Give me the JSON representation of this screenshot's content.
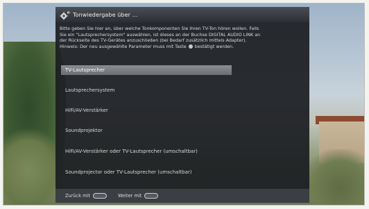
{
  "dialog": {
    "title": "Tonwiedergabe über ...",
    "description": [
      "Bitte geben Sie hier an, über welche Tonkomponenten Sie Ihren TV-Ton hören wollen. Falls",
      "Sie ein \"Lautsprechersystem\" auswählen, ist dieses an der Buchse DIGITAL AUDIO LINK an",
      "der Rückseite des TV-Gerätes anzuschließen (bei Bedarf zusätzlich mittels Adapter).",
      "Hinweis: Der neu ausgewählte Parameter muss mit Taste",
      "bestätigt werden."
    ],
    "options": [
      {
        "label": "TV-Lautsprecher",
        "selected": true
      },
      {
        "label": "Lautsprechersystem",
        "selected": false
      },
      {
        "label": "HiFi/AV-Verstärker",
        "selected": false
      },
      {
        "label": "Soundprojektor",
        "selected": false
      },
      {
        "label": "HiFi/AV-Verstärker oder TV-Lautsprecher (umschaltbar)",
        "selected": false
      },
      {
        "label": "Soundprojector oder TV-Lautsprecher (umschaltbar)",
        "selected": false
      }
    ],
    "footer": {
      "back_label": "Zurück mit",
      "next_label": "Weiter mit"
    }
  },
  "icons": {
    "title": "speaker-gear-icon",
    "ok_key": "ok-key-icon",
    "back_key": "back-key-icon",
    "next_key": "next-key-icon"
  }
}
